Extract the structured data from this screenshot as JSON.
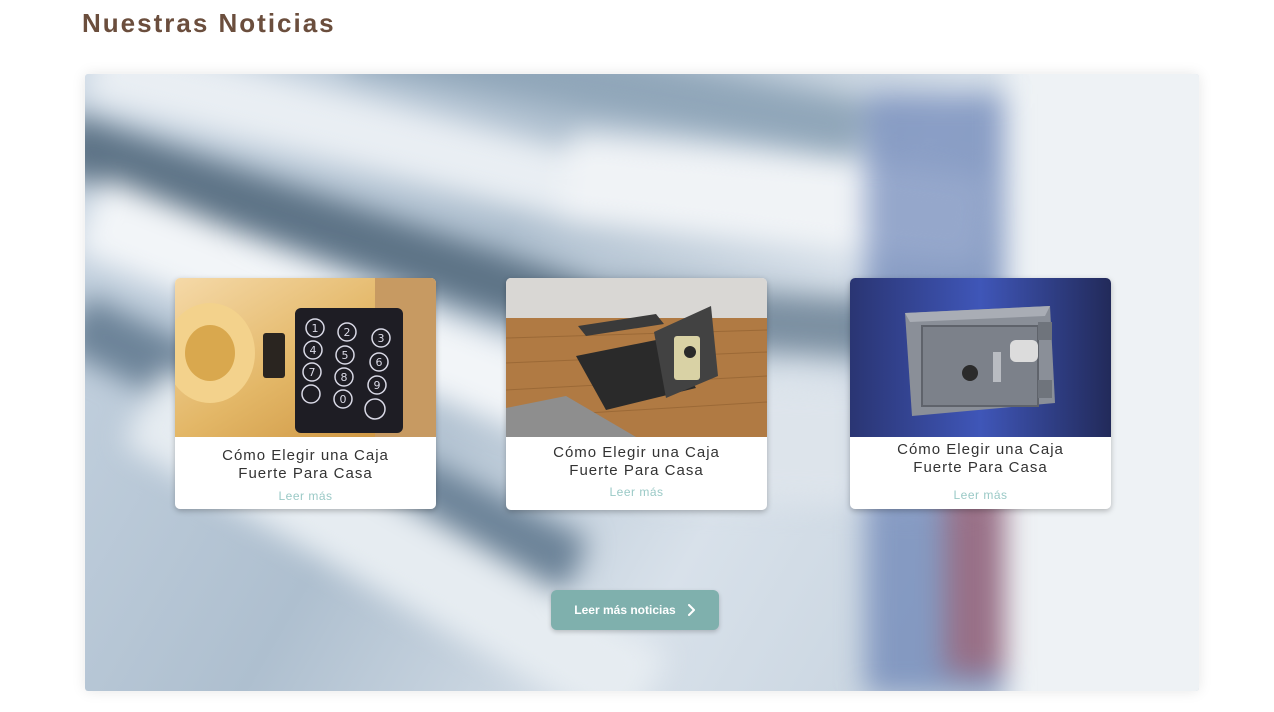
{
  "section": {
    "title": "Nuestras Noticias"
  },
  "news": [
    {
      "title": "Cómo Elegir una Caja Fuerte Para Casa",
      "link_label": "Leer más",
      "image_icon": "keypad-safe-image"
    },
    {
      "title": "Cómo Elegir una Caja Fuerte Para Casa",
      "link_label": "Leer más",
      "image_icon": "floor-safe-image"
    },
    {
      "title": "Cómo Elegir una Caja Fuerte Para Casa",
      "link_label": "Leer más",
      "image_icon": "gray-safe-image"
    }
  ],
  "more_button": {
    "label": "Leer más noticias",
    "icon": "chevron-right-icon"
  },
  "colors": {
    "title": "#6b4e3d",
    "button": "#7fb0ad",
    "link": "#9ac9c6"
  }
}
